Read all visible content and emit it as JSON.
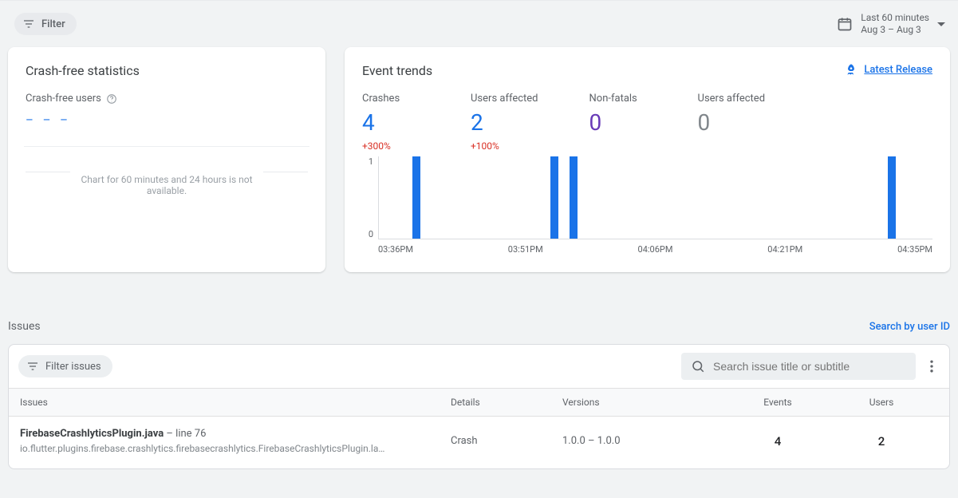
{
  "topbar": {
    "filter_label": "Filter",
    "date_range": {
      "title": "Last 60 minutes",
      "subtitle": "Aug 3 – Aug 3"
    }
  },
  "crash_free": {
    "title": "Crash-free statistics",
    "users_label": "Crash-free users",
    "value_placeholder": "–  –  –",
    "chart_unavailable": "Chart for 60 minutes and 24 hours is not available."
  },
  "event_trends": {
    "title": "Event trends",
    "latest_release_label": "Latest Release",
    "metrics": [
      {
        "label": "Crashes",
        "value": "4",
        "delta": "+300%",
        "cls": "blue"
      },
      {
        "label": "Users affected",
        "value": "2",
        "delta": "+100%",
        "cls": "blue"
      },
      {
        "label": "Non-fatals",
        "value": "0",
        "delta": "",
        "cls": "purple"
      },
      {
        "label": "Users affected",
        "value": "0",
        "delta": "",
        "cls": "gray"
      }
    ]
  },
  "chart_data": {
    "type": "bar",
    "xlabel": "",
    "ylabel": "",
    "ylim": [
      0,
      1
    ],
    "y_ticks": [
      0,
      1
    ],
    "x_ticks": [
      "03:36PM",
      "03:51PM",
      "04:06PM",
      "04:21PM",
      "04:35PM"
    ],
    "series": [
      {
        "name": "Crashes",
        "color": "#1a73e8",
        "points": [
          {
            "x": "03:37PM",
            "y": 1,
            "x_pct": 6.0
          },
          {
            "x": "03:52PM",
            "y": 1,
            "x_pct": 31.0
          },
          {
            "x": "03:54PM",
            "y": 1,
            "x_pct": 34.5
          },
          {
            "x": "04:34PM",
            "y": 1,
            "x_pct": 92.0
          }
        ]
      }
    ]
  },
  "issues": {
    "section_title": "Issues",
    "search_by_user": "Search by user ID",
    "toolbar": {
      "filter_label": "Filter issues",
      "search_placeholder": "Search issue title or subtitle"
    },
    "columns": {
      "issues": "Issues",
      "details": "Details",
      "versions": "Versions",
      "events": "Events",
      "users": "Users"
    },
    "rows": [
      {
        "title_file": "FirebaseCrashlyticsPlugin.java",
        "title_line": " – line 76",
        "subtitle": "io.flutter.plugins.firebase.crashlytics.firebasecrashlytics.FirebaseCrashlyticsPlugin.la…",
        "details": "Crash",
        "versions": "1.0.0 – 1.0.0",
        "events": "4",
        "users": "2"
      }
    ]
  }
}
